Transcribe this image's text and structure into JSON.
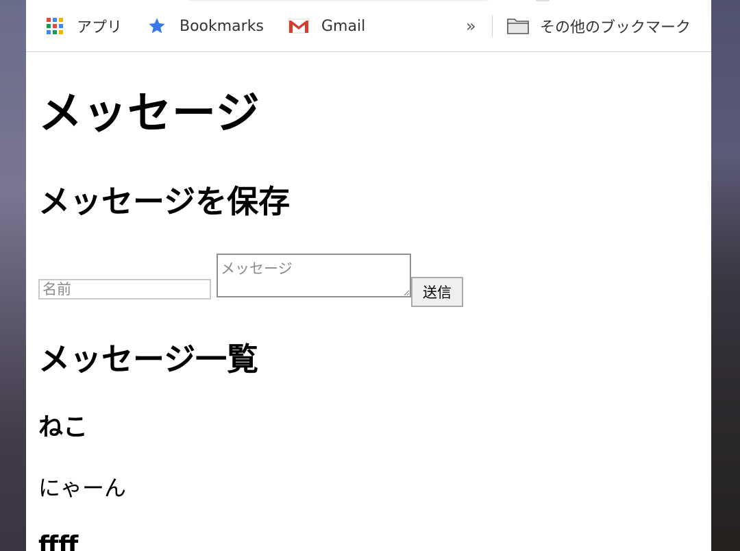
{
  "bookmarks_bar": {
    "apps_label": "アプリ",
    "bookmarks_label": "Bookmarks",
    "gmail_label": "Gmail",
    "overflow_label": "»",
    "other_bookmarks_label": "その他のブックマーク"
  },
  "page": {
    "title": "メッセージ",
    "save_heading": "メッセージを保存",
    "list_heading": "メッセージ一覧"
  },
  "form": {
    "name_placeholder": "名前",
    "message_placeholder": "メッセージ",
    "send_label": "送信"
  },
  "messages": [
    {
      "name": "ねこ",
      "body": "にゃーん"
    },
    {
      "name": "ffff"
    }
  ],
  "colors": {
    "bookmark_star": "#3b78e7",
    "text": "#000000",
    "toolbar_text": "#333333",
    "button_bg": "#efefef"
  }
}
